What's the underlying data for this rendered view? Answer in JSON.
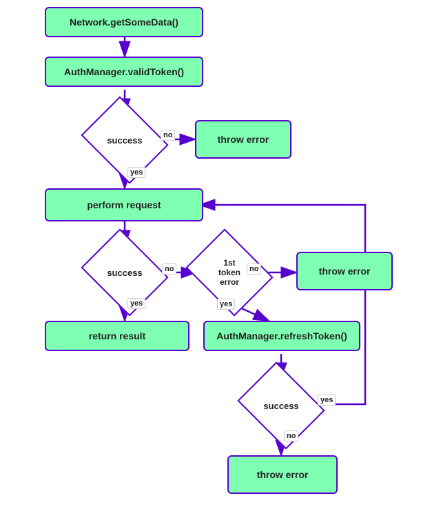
{
  "nodes": {
    "getSomeData": {
      "label": "Network.getSomeData()"
    },
    "validToken": {
      "label": "AuthManager.validToken()"
    },
    "throwError1": {
      "label": "throw error"
    },
    "success1": {
      "label": "success"
    },
    "performRequest": {
      "label": "perform request"
    },
    "success2": {
      "label": "success"
    },
    "tokenError": {
      "label": "1st\ntoken\nerror"
    },
    "throwError2": {
      "label": "throw error"
    },
    "returnResult": {
      "label": "return result"
    },
    "refreshToken": {
      "label": "AuthManager.refreshToken()"
    },
    "success3": {
      "label": "success"
    },
    "throwError3": {
      "label": "throw error"
    }
  },
  "labels": {
    "no": "no",
    "yes": "yes"
  }
}
